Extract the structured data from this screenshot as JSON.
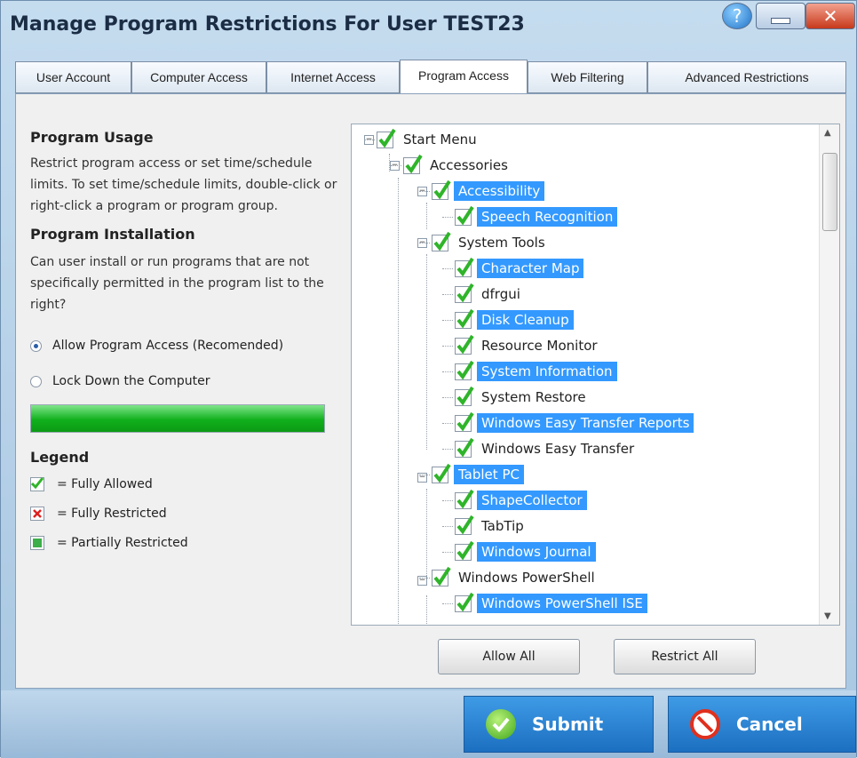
{
  "window": {
    "title": "Manage Program Restrictions For User TEST23"
  },
  "tabs": [
    {
      "label": "User Account",
      "active": false
    },
    {
      "label": "Computer Access",
      "active": false
    },
    {
      "label": "Internet Access",
      "active": false
    },
    {
      "label": "Program Access",
      "active": true
    },
    {
      "label": "Web Filtering",
      "active": false
    },
    {
      "label": "Advanced Restrictions",
      "active": false
    }
  ],
  "left": {
    "usage_heading": "Program Usage",
    "usage_text": "Restrict program access or set time/schedule limits. To set time/schedule limits, double-click or right-click a program or program group.",
    "install_heading": "Program Installation",
    "install_text": "Can user install or run programs that are not specifically permitted in the program list to the right?",
    "radio_allow": "Allow Program Access (Recomended)",
    "radio_lock": "Lock Down the Computer",
    "selected_option": "Allow Program Access (Recomended)",
    "legend_heading": "Legend",
    "legend_allowed": "= Fully Allowed",
    "legend_restricted": "= Fully Restricted",
    "legend_partial": "= Partially Restricted"
  },
  "tree": [
    {
      "label": "Start Menu",
      "level": 0,
      "selected": false,
      "expandable": true
    },
    {
      "label": "Accessories",
      "level": 1,
      "selected": false,
      "expandable": true
    },
    {
      "label": "Accessibility",
      "level": 2,
      "selected": true,
      "expandable": true
    },
    {
      "label": "Speech Recognition",
      "level": 3,
      "selected": true,
      "expandable": false
    },
    {
      "label": "System Tools",
      "level": 2,
      "selected": false,
      "expandable": true
    },
    {
      "label": "Character Map",
      "level": 3,
      "selected": true,
      "expandable": false
    },
    {
      "label": "dfrgui",
      "level": 3,
      "selected": false,
      "expandable": false
    },
    {
      "label": "Disk Cleanup",
      "level": 3,
      "selected": true,
      "expandable": false
    },
    {
      "label": "Resource Monitor",
      "level": 3,
      "selected": false,
      "expandable": false
    },
    {
      "label": "System Information",
      "level": 3,
      "selected": true,
      "expandable": false
    },
    {
      "label": "System Restore",
      "level": 3,
      "selected": false,
      "expandable": false
    },
    {
      "label": "Windows Easy Transfer Reports",
      "level": 3,
      "selected": true,
      "expandable": false
    },
    {
      "label": "Windows Easy Transfer",
      "level": 3,
      "selected": false,
      "expandable": false
    },
    {
      "label": "Tablet PC",
      "level": 2,
      "selected": true,
      "expandable": true
    },
    {
      "label": "ShapeCollector",
      "level": 3,
      "selected": true,
      "expandable": false
    },
    {
      "label": "TabTip",
      "level": 3,
      "selected": false,
      "expandable": false
    },
    {
      "label": "Windows Journal",
      "level": 3,
      "selected": true,
      "expandable": false
    },
    {
      "label": "Windows PowerShell",
      "level": 2,
      "selected": false,
      "expandable": true
    },
    {
      "label": "Windows PowerShell ISE",
      "level": 3,
      "selected": true,
      "expandable": false
    }
  ],
  "buttons": {
    "allow_all": "Allow All",
    "restrict_all": "Restrict All",
    "submit": "Submit",
    "cancel": "Cancel"
  },
  "colors": {
    "selection": "#3399ff",
    "check_green": "#2fb42a",
    "progress_green": "#10b01c",
    "footer_button": "#2a84d6"
  }
}
